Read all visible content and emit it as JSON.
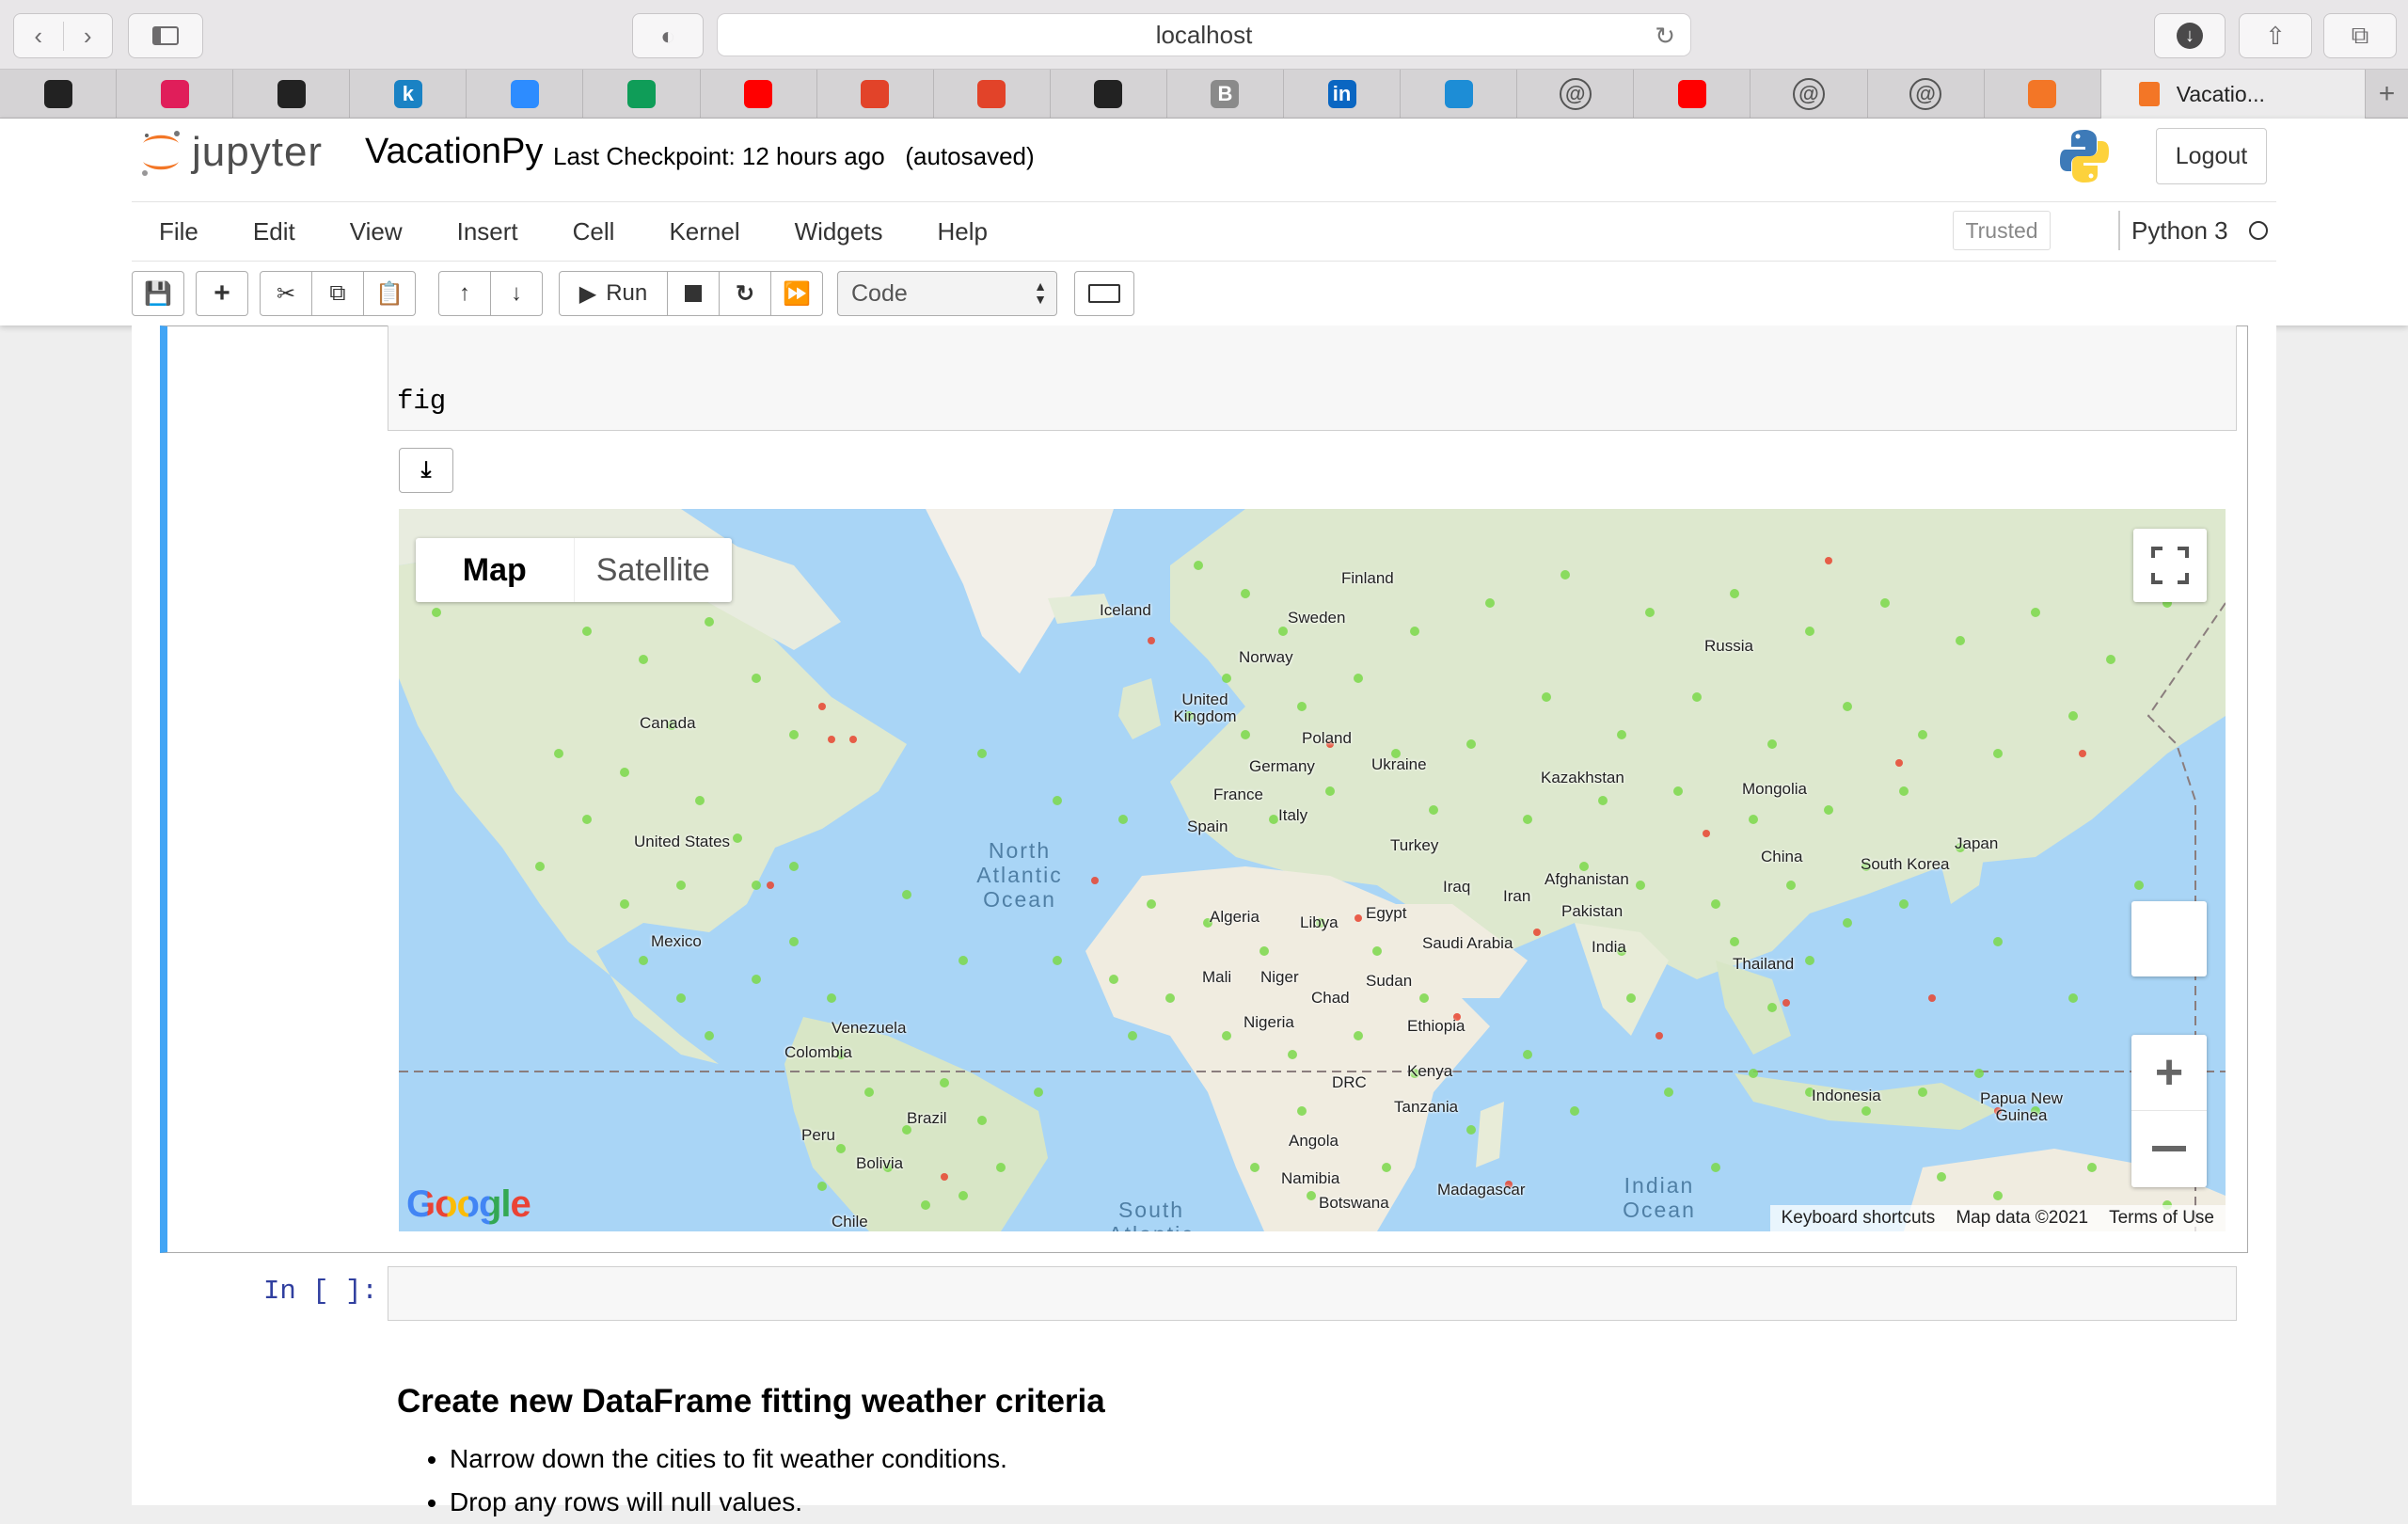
{
  "browser": {
    "address": "localhost",
    "tabs": [
      {
        "icon": "github-icon",
        "label": "",
        "color": "#222222"
      },
      {
        "icon": "slack-icon",
        "label": "",
        "color": "#e01e5a"
      },
      {
        "icon": "github-icon",
        "label": "",
        "color": "#222222"
      },
      {
        "icon": "k-icon",
        "label": "k",
        "color": "#1a82c4"
      },
      {
        "icon": "zoom-icon",
        "label": "",
        "color": "#2d8cff"
      },
      {
        "icon": "sheets-icon",
        "label": "",
        "color": "#0f9d58"
      },
      {
        "icon": "youtube-icon",
        "label": "",
        "color": "#ff0000"
      },
      {
        "icon": "gitlab-icon",
        "label": "",
        "color": "#e24329"
      },
      {
        "icon": "gitlab-icon",
        "label": "",
        "color": "#e24329"
      },
      {
        "icon": "github-icon",
        "label": "",
        "color": "#222222"
      },
      {
        "icon": "b-icon",
        "label": "B",
        "color": "#8a8a8a"
      },
      {
        "icon": "linkedin-icon",
        "label": "in",
        "color": "#0a66c2"
      },
      {
        "icon": "video-icon",
        "label": "",
        "color": "#1d8dd6"
      },
      {
        "icon": "at-icon",
        "label": "@",
        "color": "#555555"
      },
      {
        "icon": "youtube-icon",
        "label": "",
        "color": "#ff0000"
      },
      {
        "icon": "at-icon",
        "label": "@",
        "color": "#555555"
      },
      {
        "icon": "at-icon",
        "label": "@",
        "color": "#555555"
      },
      {
        "icon": "jupyter-icon",
        "label": "",
        "color": "#f37626"
      }
    ],
    "active_tab_label": "Vacatio..."
  },
  "jupyter": {
    "logo_text": "jupyter",
    "notebook_name": "VacationPy",
    "checkpoint": "Last Checkpoint: 12 hours ago",
    "autosaved": "(autosaved)",
    "logout": "Logout",
    "menu": [
      "File",
      "Edit",
      "View",
      "Insert",
      "Cell",
      "Kernel",
      "Widgets",
      "Help"
    ],
    "trusted": "Trusted",
    "kernel_name": "Python 3",
    "run_label": "Run",
    "cell_type": "Code"
  },
  "cell": {
    "code_last_line": "fig"
  },
  "map": {
    "type_map": "Map",
    "type_satellite": "Satellite",
    "attribution": [
      "Keyboard shortcuts",
      "Map data ©2021",
      "Terms of Use"
    ],
    "logo": "Google",
    "places": [
      "Finland",
      "Sweden",
      "Norway",
      "Iceland",
      "Russia",
      "United Kingdom",
      "Poland",
      "Germany",
      "Ukraine",
      "France",
      "Italy",
      "Spain",
      "Kazakhstan",
      "Mongolia",
      "Canada",
      "United States",
      "Turkey",
      "Iraq",
      "Iran",
      "Afghanistan",
      "Pakistan",
      "China",
      "South Korea",
      "Japan",
      "Algeria",
      "Libya",
      "Egypt",
      "Saudi Arabia",
      "India",
      "Thailand",
      "Mexico",
      "Mali",
      "Niger",
      "Chad",
      "Sudan",
      "Ethiopia",
      "Nigeria",
      "Venezuela",
      "Colombia",
      "Kenya",
      "DRC",
      "Tanzania",
      "Brazil",
      "Peru",
      "Bolivia",
      "Angola",
      "Namibia",
      "Botswana",
      "Madagascar",
      "Indonesia",
      "Papua New Guinea",
      "Chile"
    ],
    "oceans": [
      "North Atlantic Ocean",
      "Indian Ocean",
      "South Atlantic"
    ]
  },
  "next_cell": {
    "prompt": "In [ ]:"
  },
  "markdown": {
    "heading": "Create new DataFrame fitting weather criteria",
    "bullets": [
      "Narrow down the cities to fit weather conditions.",
      "Drop any rows will null values."
    ]
  }
}
